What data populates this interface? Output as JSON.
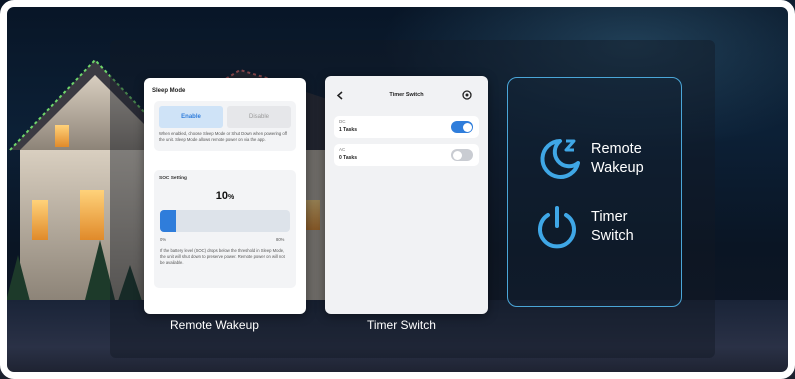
{
  "sleep_mode": {
    "title": "Sleep Mode",
    "enable_label": "Enable",
    "disable_label": "Disable",
    "description": "When enabled, choose Sleep Mode or Shut Down when powering off the unit. Sleep Mode allows remote power on via the app.",
    "soc_title": "SOC Setting",
    "soc_value": "10",
    "soc_unit": "%",
    "soc_level_percent": 10,
    "slider_min": "0%",
    "slider_max": "80%",
    "warning": "If the battery level (SOC) drops below the threshold in Sleep Mode, the unit will shut down to preserve power. Remote power on will not be available."
  },
  "timer_switch": {
    "title": "Timer Switch",
    "rows": [
      {
        "name": "DC",
        "tasks": "1 Tasks",
        "on": true
      },
      {
        "name": "AC",
        "tasks": "0 Tasks",
        "on": false
      }
    ]
  },
  "captions": {
    "left": "Remote Wakeup",
    "right": "Timer Switch"
  },
  "features": {
    "remote_wakeup_line1": "Remote",
    "remote_wakeup_line2": "Wakeup",
    "timer_switch_line1": "Timer",
    "timer_switch_line2": "Switch"
  },
  "colors": {
    "accent": "#2f7ddb",
    "feature_blue": "#3fa7e6",
    "toggle_off": "#c9ccd2"
  },
  "icons": [
    "back-arrow-icon",
    "settings-icon",
    "moon-sleep-icon",
    "power-icon"
  ]
}
